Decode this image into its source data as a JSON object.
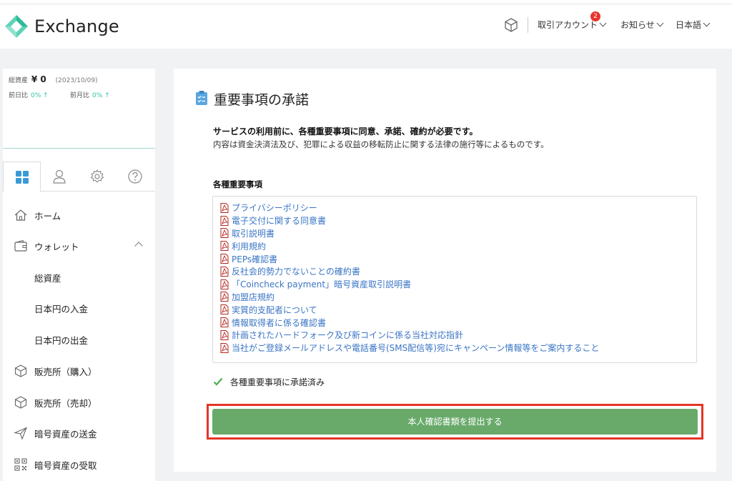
{
  "header": {
    "brand": "Exchange",
    "menus": [
      {
        "label": "取引アカウント",
        "badge": "2"
      },
      {
        "label": "お知らせ"
      },
      {
        "label": "日本語"
      }
    ]
  },
  "sidebar": {
    "assets_label": "総資産",
    "assets_amount": "¥ 0",
    "assets_date": "(2023/10/09)",
    "day_diff_label": "前日比",
    "day_diff_value": "0% ↑",
    "month_diff_label": "前月比",
    "month_diff_value": "0% ↑",
    "tabs": [
      "grid-icon",
      "user-icon",
      "gear-icon",
      "help-icon"
    ],
    "nav": [
      {
        "label": "ホーム",
        "icon": "home-icon"
      },
      {
        "label": "ウォレット",
        "icon": "wallet-icon"
      },
      {
        "label": "総資産"
      },
      {
        "label": "日本円の入金"
      },
      {
        "label": "日本円の出金"
      },
      {
        "label": "販売所（購入）",
        "icon": "box-icon"
      },
      {
        "label": "販売所（売却）",
        "icon": "box-icon"
      },
      {
        "label": "暗号資産の送金",
        "icon": "send-icon"
      },
      {
        "label": "暗号資産の受取",
        "icon": "qr-icon"
      }
    ]
  },
  "main": {
    "title": "重要事項の承諾",
    "intro_bold": "サービスの利用前に、各種重要事項に同意、承諾、確約が必要です。",
    "intro_body": "内容は資金決済法及び、犯罪による収益の移転防止に関する法律の施行等によるものです。",
    "section_heading": "各種重要事項",
    "documents": [
      "プライバシーポリシー",
      "電子交付に関する同意書",
      "取引説明書",
      "利用規約",
      "PEPs確認書",
      "反社会的勢力でないことの確約書",
      "「Coincheck payment」暗号資産取引説明書",
      "加盟店規約",
      "実質的支配者について",
      "情報取得者に係る確認書",
      "計画されたハードフォーク及び新コインに係る当社対応指針",
      "当社がご登録メールアドレスや電話番号(SMS配信等)宛にキャンペーン情報等をご案内すること"
    ],
    "agreed_text": "各種重要事項に承諾済み",
    "submit_label": "本人確認書類を提出する"
  },
  "colors": {
    "accent_green": "#69aa6b",
    "link_blue": "#3a75c4",
    "highlight_red": "#e63526",
    "teal": "#36c2a4"
  }
}
